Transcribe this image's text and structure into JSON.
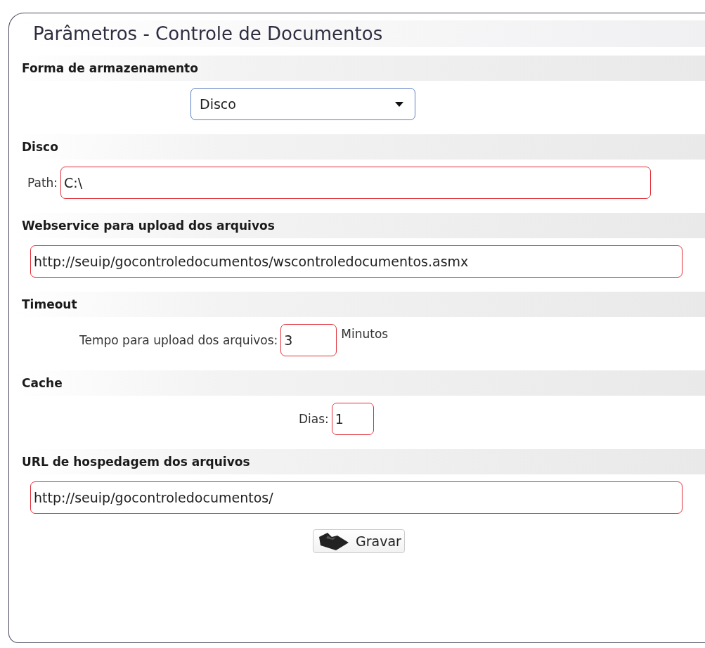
{
  "panel": {
    "title": "Parâmetros - Controle de Documentos"
  },
  "sections": [
    {
      "title": "Forma de armazenamento",
      "kind": "select",
      "value": "Disco"
    },
    {
      "title": "Disco",
      "kind": "labeled",
      "label": "Path:",
      "value": "C:\\"
    },
    {
      "title": "Webservice para upload dos arquivos",
      "kind": "url",
      "value": "http://seuip/gocontroledocumentos/wscontroledocumentos.asmx"
    },
    {
      "title": "Timeout",
      "kind": "timeout",
      "label": "Tempo para upload dos arquivos:",
      "value": "3",
      "suffix": "Minutos"
    },
    {
      "title": "Cache",
      "kind": "days",
      "label": "Dias:",
      "value": "1"
    },
    {
      "title": "URL de hospedagem dos arquivos",
      "kind": "url",
      "value": "http://seuip/gocontroledocumentos/"
    }
  ],
  "save_button": {
    "label": "Gravar"
  }
}
